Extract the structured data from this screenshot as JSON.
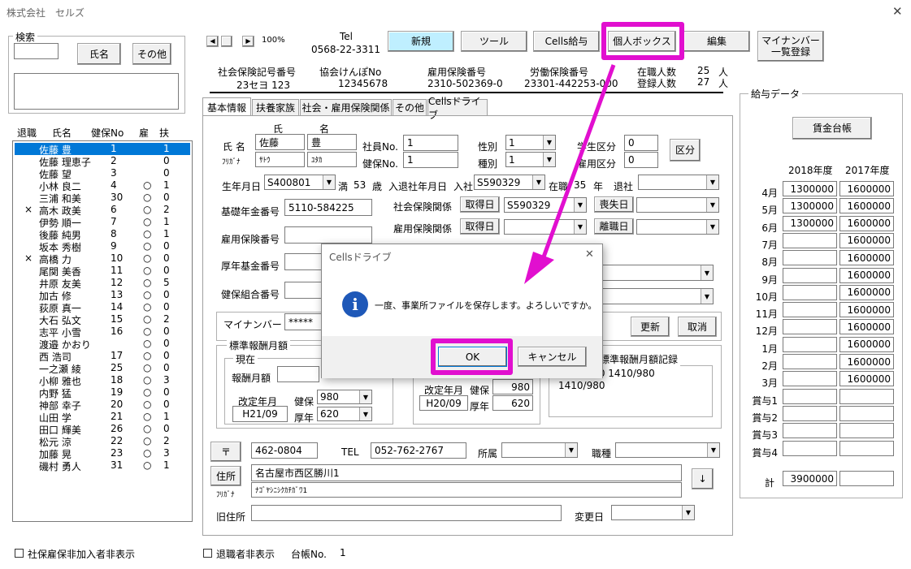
{
  "window": {
    "title": "株式会社　セルズ",
    "close": "✕"
  },
  "search": {
    "label": "検索",
    "name_button": "氏名",
    "other_button": "その他"
  },
  "list_header": {
    "retire": "退職",
    "name": "氏名",
    "insno": "健保No",
    "koyo": "雇",
    "fuyo": "扶"
  },
  "employees": [
    {
      "mark": "",
      "name": "佐藤 豊",
      "no": "1",
      "koyo": "",
      "fuyo": "1",
      "selected": true
    },
    {
      "mark": "",
      "name": "佐藤 理恵子",
      "no": "2",
      "koyo": "",
      "fuyo": "0"
    },
    {
      "mark": "",
      "name": "佐藤 望",
      "no": "3",
      "koyo": "",
      "fuyo": "0"
    },
    {
      "mark": "",
      "name": "小林 良二",
      "no": "4",
      "koyo": "○",
      "fuyo": "1"
    },
    {
      "mark": "",
      "name": "三浦 和美",
      "no": "30",
      "koyo": "○",
      "fuyo": "0"
    },
    {
      "mark": "×",
      "name": "高木 政美",
      "no": "6",
      "koyo": "○",
      "fuyo": "2"
    },
    {
      "mark": "",
      "name": "伊勢 順一",
      "no": "7",
      "koyo": "○",
      "fuyo": "1"
    },
    {
      "mark": "",
      "name": "後藤 純男",
      "no": "8",
      "koyo": "○",
      "fuyo": "1"
    },
    {
      "mark": "",
      "name": "坂本 秀樹",
      "no": "9",
      "koyo": "○",
      "fuyo": "0"
    },
    {
      "mark": "×",
      "name": "高橋 力",
      "no": "10",
      "koyo": "○",
      "fuyo": "0"
    },
    {
      "mark": "",
      "name": "尾関 美香",
      "no": "11",
      "koyo": "○",
      "fuyo": "0"
    },
    {
      "mark": "",
      "name": "井原 友美",
      "no": "12",
      "koyo": "○",
      "fuyo": "5"
    },
    {
      "mark": "",
      "name": "加古 修",
      "no": "13",
      "koyo": "○",
      "fuyo": "0"
    },
    {
      "mark": "",
      "name": "荻原 真一",
      "no": "14",
      "koyo": "○",
      "fuyo": "0"
    },
    {
      "mark": "",
      "name": "大石 弘文",
      "no": "15",
      "koyo": "○",
      "fuyo": "2"
    },
    {
      "mark": "",
      "name": "志平 小雪",
      "no": "16",
      "koyo": "○",
      "fuyo": "0"
    },
    {
      "mark": "",
      "name": "渡邉 かおり",
      "no": "",
      "koyo": "○",
      "fuyo": "0"
    },
    {
      "mark": "",
      "name": "西 浩司",
      "no": "17",
      "koyo": "○",
      "fuyo": "0"
    },
    {
      "mark": "",
      "name": "一之瀬 綾",
      "no": "25",
      "koyo": "○",
      "fuyo": "0"
    },
    {
      "mark": "",
      "name": "小柳 雅也",
      "no": "18",
      "koyo": "○",
      "fuyo": "3"
    },
    {
      "mark": "",
      "name": "内野 猛",
      "no": "19",
      "koyo": "○",
      "fuyo": "0"
    },
    {
      "mark": "",
      "name": "神部 幸子",
      "no": "20",
      "koyo": "○",
      "fuyo": "0"
    },
    {
      "mark": "",
      "name": "山田 学",
      "no": "21",
      "koyo": "○",
      "fuyo": "1"
    },
    {
      "mark": "",
      "name": "田口 輝美",
      "no": "26",
      "koyo": "○",
      "fuyo": "0"
    },
    {
      "mark": "",
      "name": "松元 涼",
      "no": "22",
      "koyo": "○",
      "fuyo": "2"
    },
    {
      "mark": "",
      "name": "加藤 晃",
      "no": "23",
      "koyo": "○",
      "fuyo": "3"
    },
    {
      "mark": "",
      "name": "磯村 勇人",
      "no": "31",
      "koyo": "○",
      "fuyo": "1"
    }
  ],
  "bottom": {
    "hide_unenrolled": "社保雇保非加入者非表示",
    "hide_retired": "退職者非表示",
    "ledger_label": "台帳No.",
    "ledger_no": "1"
  },
  "toolbar": {
    "zoom": "100%",
    "tel_label": "Tel",
    "tel": "0568-22-3311",
    "new": "新規",
    "tool": "ツール",
    "cells_pay": "Cells給与",
    "personal_box": "個人ボックス",
    "edit": "編集",
    "mynumber": "マイナンバー\n一覧登録"
  },
  "company": {
    "sha_label": "社会保険記号番号",
    "sha": "23セヨ 123",
    "kyokai_label": "協会けんぽNo",
    "kyokai": "12345678",
    "koyo_label": "雇用保険番号",
    "koyo": "2310-502369-0",
    "rodo_label": "労働保険番号",
    "rodo": "23301-442253-000",
    "zaishoku_label": "在職人数",
    "zaishoku": "25",
    "toroku_label": "登録人数",
    "toroku": "27",
    "unit": "人"
  },
  "tabs": [
    "基本情報",
    "扶養家族",
    "社会・雇用保険関係",
    "その他",
    "Cellsドライブ"
  ],
  "form": {
    "uji": "氏",
    "mei": "名",
    "name_label": "氏 名",
    "furigana_label": "ﾌﾘｶﾞﾅ",
    "last": "佐藤",
    "first": "豊",
    "last_kana": "ｻﾄｳ",
    "first_kana": "ﾕﾀｶ",
    "shain_label": "社員No.",
    "shain": "1",
    "kenpo_label": "健保No.",
    "kenpo": "1",
    "sex_label": "性別",
    "sex": "1",
    "kind_label": "種別",
    "kind": "1",
    "gakusei_label": "学生区分",
    "gakusei": "0",
    "koyou_label": "雇用区分",
    "koyou": "0",
    "kubun_button": "区分",
    "birth_label": "生年月日",
    "birth": "S400801",
    "age_label": "満",
    "age": "53",
    "age_unit": "歳",
    "nyutai_label": "入退社年月日",
    "nyusha_label": "入社",
    "nyusha": "S590329",
    "zaishoku_label": "在職",
    "zaishoku": "35",
    "year_unit": "年",
    "taisha_label": "退社",
    "kiso_label": "基礎年金番号",
    "kiso": "5110-584225",
    "shaho_label": "社会保険関係",
    "shutoku": "取得日",
    "shaho_date": "S590329",
    "soshitsu": "喪失日",
    "koyo_label": "雇用保険関係",
    "koyo_shutoku": "取得日",
    "rishoku": "離職日",
    "koyo_no_label": "雇用保険番号",
    "kosei_label": "厚年基金番号",
    "kumiai_label": "健保組合番号",
    "my_label": "マイナンバー",
    "my_value": "*****",
    "update": "更新",
    "cancel": "取消",
    "std_group": "標準報酬月額",
    "current": "現在",
    "hoshu_label": "報酬月額",
    "kaitei_label": "改定年月",
    "kenpo2": "健保",
    "konen": "厚年",
    "kaitei": "H21/09",
    "kenpo_val": "980",
    "konen_val": "620",
    "prev_kaitei_label": "改定年月",
    "prev_kaitei": "H20/09",
    "prev_kenpo": "980",
    "prev_konen": "620",
    "record_label": "標準報酬月額記録",
    "record": "1310/980 1410/980\n1410/980",
    "zip_button": "〒",
    "zip": "462-0804",
    "tel_label": "TEL",
    "tel": "052-762-2767",
    "shozoku": "所属",
    "shokushu": "職種",
    "address_button": "住所",
    "address": "名古屋市西区勝川1",
    "addr_kana_label": "ﾌﾘｶﾞﾅ",
    "addr_kana": "ﾅｺﾞﾔｼﾆｼｸｶﾁｶﾞﾜ1",
    "down": "↓",
    "old_address": "旧住所",
    "change_date": "変更日"
  },
  "salary": {
    "title": "給与データ",
    "ledger_button": "賃金台帳",
    "year1": "2018年度",
    "year2": "2017年度",
    "rows": [
      {
        "m": "4月",
        "a": "1300000",
        "b": "1600000"
      },
      {
        "m": "5月",
        "a": "1300000",
        "b": "1600000"
      },
      {
        "m": "6月",
        "a": "1300000",
        "b": "1600000"
      },
      {
        "m": "7月",
        "a": "",
        "b": "1600000"
      },
      {
        "m": "8月",
        "a": "",
        "b": "1600000"
      },
      {
        "m": "9月",
        "a": "",
        "b": "1600000"
      },
      {
        "m": "10月",
        "a": "",
        "b": "1600000"
      },
      {
        "m": "11月",
        "a": "",
        "b": "1600000"
      },
      {
        "m": "12月",
        "a": "",
        "b": "1600000"
      },
      {
        "m": "1月",
        "a": "",
        "b": "1600000"
      },
      {
        "m": "2月",
        "a": "",
        "b": "1600000"
      },
      {
        "m": "3月",
        "a": "",
        "b": "1600000"
      },
      {
        "m": "賞与1",
        "a": "",
        "b": ""
      },
      {
        "m": "賞与2",
        "a": "",
        "b": ""
      },
      {
        "m": "賞与3",
        "a": "",
        "b": ""
      },
      {
        "m": "賞与4",
        "a": "",
        "b": ""
      }
    ],
    "total_label": "計",
    "total": "3900000"
  },
  "dialog": {
    "title": "Cellsドライブ",
    "message": "一度、事業所ファイルを保存します。よろしいですか。",
    "ok": "OK",
    "cancel": "キャンセル",
    "close": "✕",
    "icon": "info-icon"
  },
  "colors": {
    "accent": "#e10fcf",
    "selection": "#0078d7",
    "new_button": "#bfefff"
  }
}
